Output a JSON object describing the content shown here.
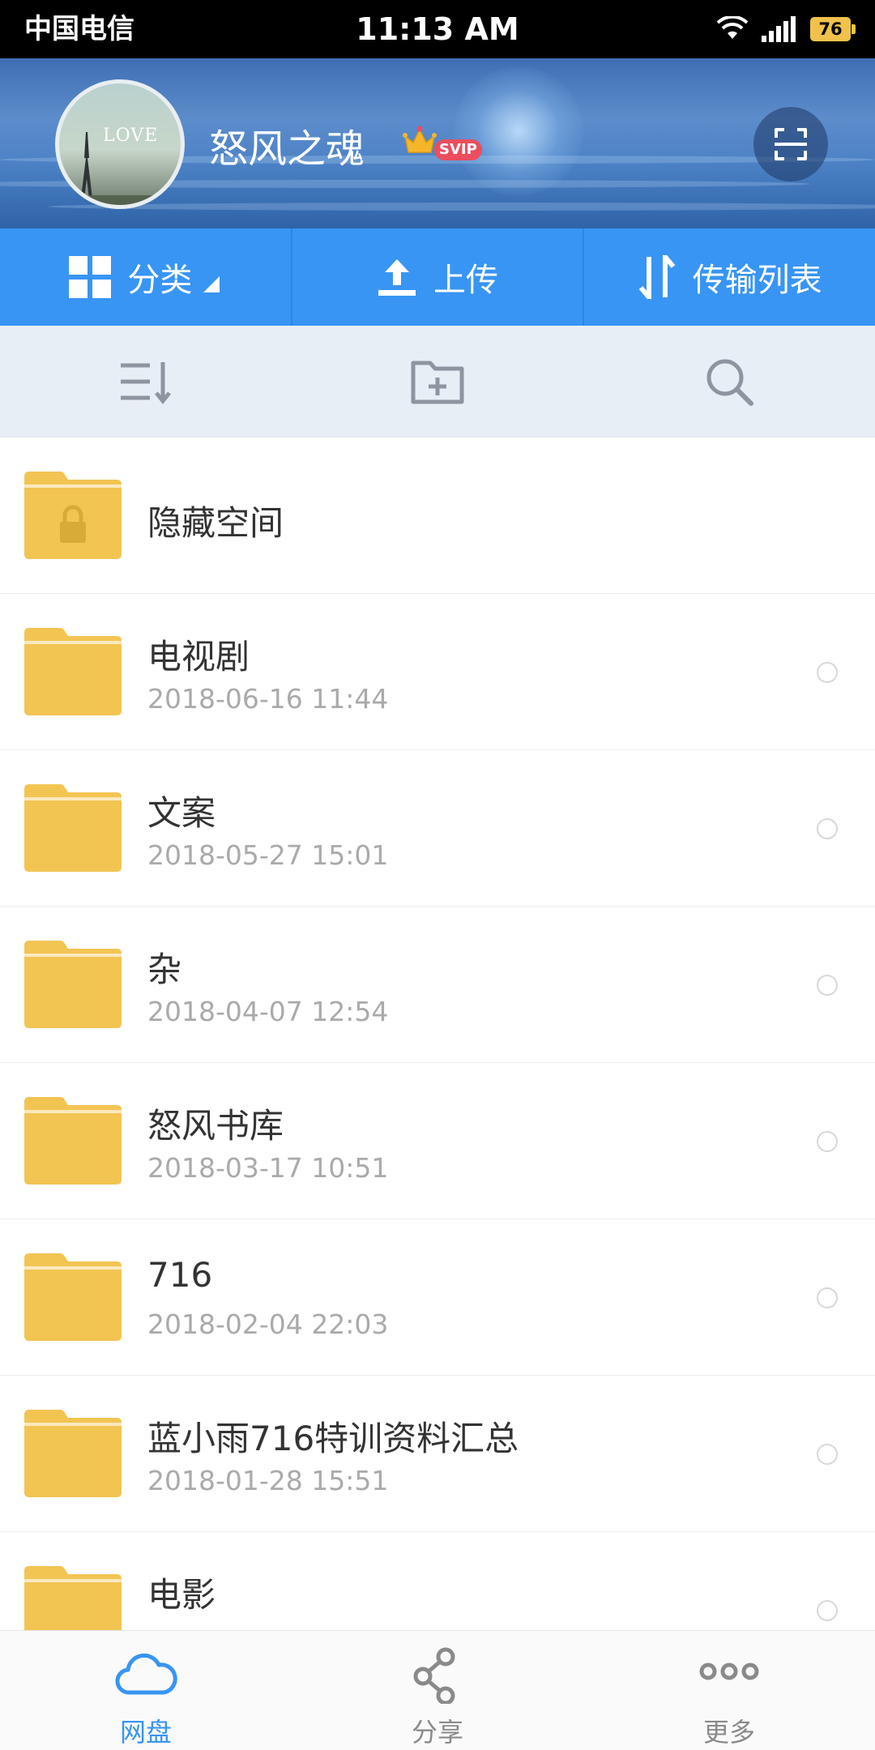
{
  "status_bar": {
    "carrier": "中国电信",
    "time": "11:13 AM",
    "battery": "76",
    "icons": [
      "wifi-icon",
      "signal-icon",
      "battery-icon"
    ]
  },
  "profile": {
    "name": "怒风之魂",
    "badge": "SVIP",
    "avatar_text": "LOVE",
    "icons": [
      "crown-icon",
      "scan-icon"
    ]
  },
  "action_bar": {
    "items": [
      {
        "label": "分类",
        "icon": "grid-icon"
      },
      {
        "label": "上传",
        "icon": "upload-icon"
      },
      {
        "label": "传输列表",
        "icon": "transfer-icon"
      }
    ]
  },
  "toolbar": {
    "icons": [
      "sort-icon",
      "new-folder-icon",
      "search-icon"
    ]
  },
  "files": [
    {
      "name": "隐藏空间",
      "date": "",
      "locked": true
    },
    {
      "name": "电视剧",
      "date": "2018-06-16  11:44"
    },
    {
      "name": "文案",
      "date": "2018-05-27  15:01"
    },
    {
      "name": "杂",
      "date": "2018-04-07  12:54"
    },
    {
      "name": "怒风书库",
      "date": "2018-03-17  10:51"
    },
    {
      "name": "716",
      "date": "2018-02-04  22:03"
    },
    {
      "name": "蓝小雨716特训资料汇总",
      "date": "2018-01-28  15:51"
    },
    {
      "name": "电影",
      "date": ""
    }
  ],
  "bottom_nav": {
    "items": [
      {
        "label": "网盘",
        "icon": "cloud-icon",
        "active": true
      },
      {
        "label": "分享",
        "icon": "share-icon",
        "active": false
      },
      {
        "label": "更多",
        "icon": "more-icon",
        "active": false
      }
    ]
  },
  "colors": {
    "accent": "#3895f3",
    "folder": "#f2c452",
    "toolbar_bg": "#e8eef6",
    "status_bar_bg": "#000000"
  }
}
